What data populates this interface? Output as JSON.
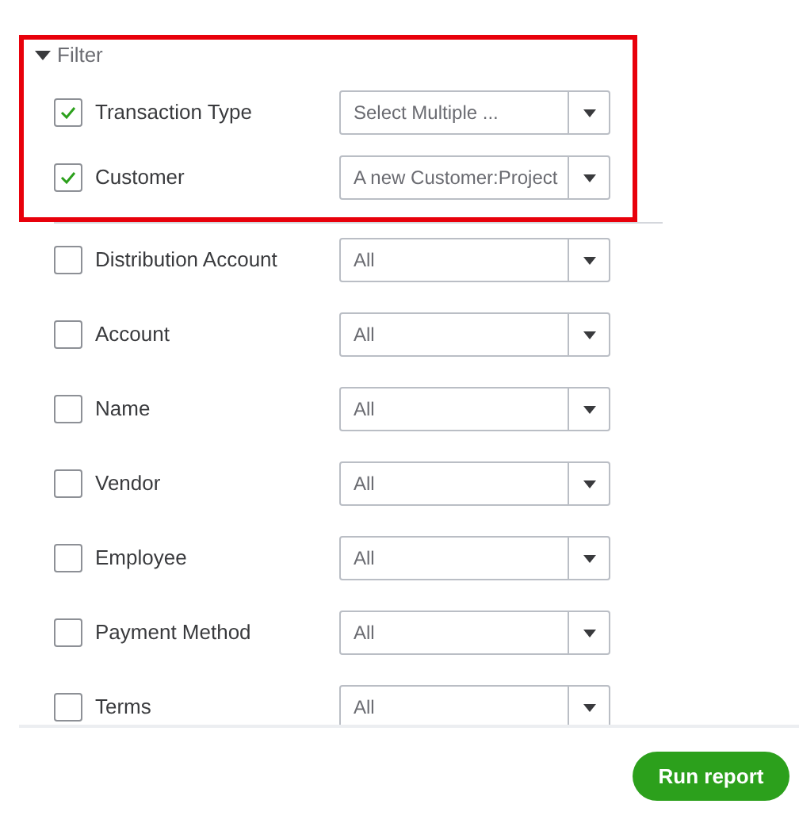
{
  "filter": {
    "title": "Filter",
    "expanded": true,
    "highlighted_rows": [
      {
        "label": "Transaction Type",
        "checked": true,
        "value": "Select Multiple ..."
      },
      {
        "label": "Customer",
        "checked": true,
        "value": "A new Customer:Project"
      }
    ],
    "rows": [
      {
        "label": "Distribution Account",
        "checked": false,
        "value": "All"
      },
      {
        "label": "Account",
        "checked": false,
        "value": "All"
      },
      {
        "label": "Name",
        "checked": false,
        "value": "All"
      },
      {
        "label": "Vendor",
        "checked": false,
        "value": "All"
      },
      {
        "label": "Employee",
        "checked": false,
        "value": "All"
      },
      {
        "label": "Payment Method",
        "checked": false,
        "value": "All"
      },
      {
        "label": "Terms",
        "checked": false,
        "value": "All"
      }
    ]
  },
  "run_button": "Run report"
}
